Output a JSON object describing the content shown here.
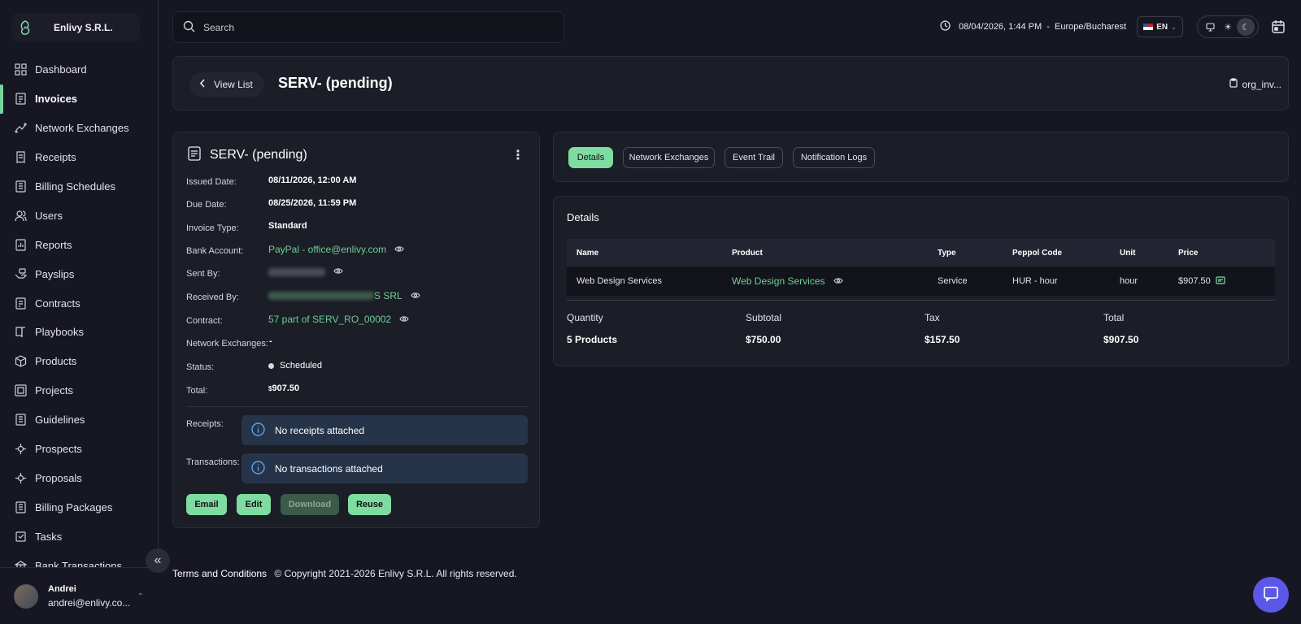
{
  "org": {
    "name": "Enlivy S.R.L."
  },
  "sidebar": {
    "items": [
      {
        "label": "Dashboard",
        "icon": "dashboard-icon"
      },
      {
        "label": "Invoices",
        "icon": "invoice-icon",
        "active": true
      },
      {
        "label": "Network Exchanges",
        "icon": "network-icon"
      },
      {
        "label": "Receipts",
        "icon": "receipt-icon"
      },
      {
        "label": "Billing Schedules",
        "icon": "schedule-icon"
      },
      {
        "label": "Users",
        "icon": "users-icon"
      },
      {
        "label": "Reports",
        "icon": "report-icon"
      },
      {
        "label": "Payslips",
        "icon": "payslip-icon"
      },
      {
        "label": "Contracts",
        "icon": "contract-icon"
      },
      {
        "label": "Playbooks",
        "icon": "playbook-icon"
      },
      {
        "label": "Products",
        "icon": "product-icon"
      },
      {
        "label": "Projects",
        "icon": "project-icon"
      },
      {
        "label": "Guidelines",
        "icon": "guideline-icon"
      },
      {
        "label": "Prospects",
        "icon": "prospect-icon"
      },
      {
        "label": "Proposals",
        "icon": "proposal-icon"
      },
      {
        "label": "Billing Packages",
        "icon": "package-icon"
      },
      {
        "label": "Tasks",
        "icon": "task-icon"
      },
      {
        "label": "Bank Transactions",
        "icon": "bank-icon"
      }
    ]
  },
  "user": {
    "name": "Andrei",
    "email": "andrei@enlivy.co..."
  },
  "topbar": {
    "search_placeholder": "Search",
    "datetime": "08/04/2026, 1:44 PM  -  Europe/Bucharest",
    "lang": "EN"
  },
  "header": {
    "back_label": "View List",
    "title": "SERV- (pending)",
    "org_file": "org_inv..."
  },
  "invoice": {
    "title": "SERV- (pending)",
    "fields": {
      "issued_label": "Issued Date:",
      "issued": "08/11/2026, 12:00 AM",
      "due_label": "Due Date:",
      "due": "08/25/2026, 11:59 PM",
      "type_label": "Invoice Type:",
      "type": "Standard",
      "bank_label": "Bank Account:",
      "bank": "PayPal - office@enlivy.com",
      "sent_label": "Sent By:",
      "received_label": "Received By:",
      "received_suffix": "S SRL",
      "contract_label": "Contract:",
      "contract": "57 part of SERV_RO_00002",
      "network_label": "Network Exchanges:",
      "network": "-",
      "status_label": "Status:",
      "status": "Scheduled",
      "total_label": "Total:",
      "total_currency": "$",
      "total": "907.50"
    },
    "receipts_label": "Receipts:",
    "receipts_empty": "No receipts attached",
    "transactions_label": "Transactions:",
    "transactions_empty": "No transactions attached",
    "buttons": {
      "email": "Email",
      "edit": "Edit",
      "download": "Download",
      "reuse": "Reuse"
    }
  },
  "tabs": [
    "Details",
    "Network Exchanges",
    "Event Trail",
    "Notification Logs"
  ],
  "details": {
    "title": "Details",
    "columns": [
      "Name",
      "Product",
      "Type",
      "Peppol Code",
      "Unit",
      "Price"
    ],
    "row": {
      "name": "Web Design Services",
      "product": "Web Design Services",
      "type": "Service",
      "peppol": "HUR - hour",
      "unit": "hour",
      "price": "$907.50"
    },
    "summary": {
      "quantity_label": "Quantity",
      "quantity": "5 Products",
      "subtotal_label": "Subtotal",
      "subtotal": "$750.00",
      "tax_label": "Tax",
      "tax": "$157.50",
      "total_label": "Total",
      "total": "$907.50"
    }
  },
  "footer": {
    "terms": "Terms and Conditions",
    "copyright": "© Copyright 2021-2026 Enlivy S.R.L. All rights reserved."
  },
  "colors": {
    "accent": "#7fdca0",
    "link": "#6fcf97",
    "chat": "#5b58e8"
  }
}
